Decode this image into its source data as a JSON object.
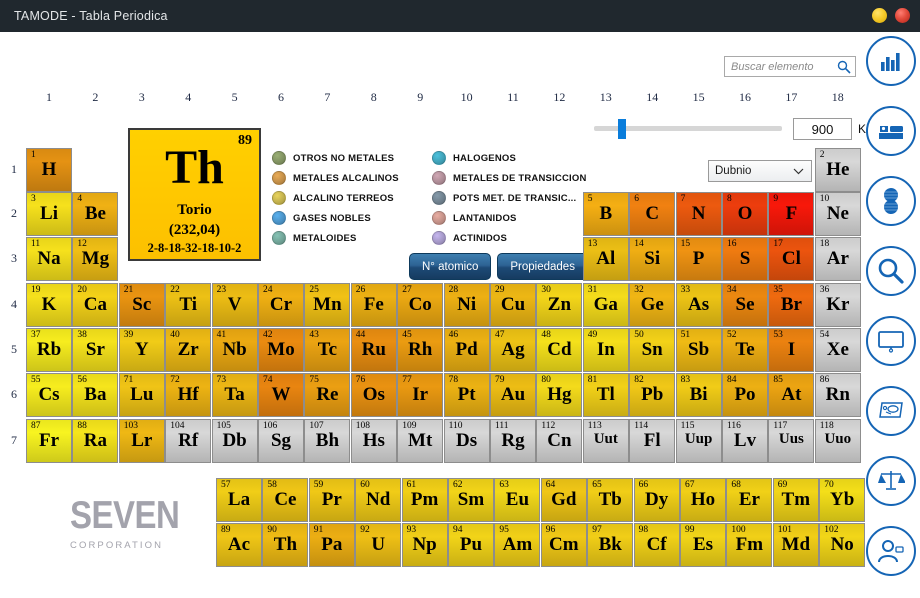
{
  "window": {
    "title": "TAMODE - Tabla Periodica",
    "minimize_label": "",
    "close_label": ""
  },
  "search": {
    "placeholder": "Buscar elemento",
    "value": "",
    "icon": "search-icon"
  },
  "temperature": {
    "value": "900",
    "unit": "K",
    "slider_min": "0",
    "slider_max": "6000"
  },
  "element_select": {
    "value": "Dubnio",
    "arrow_icon": "chevron-down-icon"
  },
  "selected_element": {
    "number": "89",
    "symbol": "Th",
    "name": "Torio",
    "mass": "(232,04)",
    "config": "2-8-18-32-18-10-2"
  },
  "mode_buttons": [
    {
      "label": "N° atomico"
    },
    {
      "label": "Propiedades"
    }
  ],
  "legend": {
    "left": [
      {
        "label": "OTROS NO METALES",
        "color": "#7f9060"
      },
      {
        "label": "METALES ALCALINOS",
        "color": "#c08d47"
      },
      {
        "label": "ALCALINO TERREOS",
        "color": "#bfae4c"
      },
      {
        "label": "GASES NOBLES",
        "color": "#4a91c4"
      },
      {
        "label": "METALOIDES",
        "color": "#6fa195"
      }
    ],
    "right": [
      {
        "label": "HALOGENOS",
        "color": "#3f9fb5"
      },
      {
        "label": "METALES DE TRANSICCION",
        "color": "#ab8a94"
      },
      {
        "label": "POTS MET.  DE TRANSIC...",
        "color": "#6e7f8c"
      },
      {
        "label": "LANTANIDOS",
        "color": "#c08f86"
      },
      {
        "label": "ACTINIDOS",
        "color": "#a296c4"
      }
    ]
  },
  "group_numbers": [
    "1",
    "2",
    "3",
    "4",
    "5",
    "6",
    "7",
    "8",
    "9",
    "10",
    "11",
    "12",
    "13",
    "14",
    "15",
    "16",
    "17",
    "18"
  ],
  "period_numbers": [
    "1",
    "2",
    "3",
    "4",
    "5",
    "6",
    "7"
  ],
  "sidebar_icons": [
    {
      "name": "bar-chart-icon"
    },
    {
      "name": "bed-icon"
    },
    {
      "name": "atom-icon"
    },
    {
      "name": "magnifier-icon"
    },
    {
      "name": "monitor-icon"
    },
    {
      "name": "lab-tray-icon"
    },
    {
      "name": "balance-scale-icon"
    },
    {
      "name": "user-icon"
    }
  ],
  "branding": {
    "name": "SEVEN",
    "tagline": "CORPORATION"
  },
  "elements": [
    {
      "n": "1",
      "s": "H",
      "g": 1,
      "p": 1,
      "c": "#d88a12"
    },
    {
      "n": "2",
      "s": "He",
      "g": 18,
      "p": 1,
      "c": "#cccccc"
    },
    {
      "n": "3",
      "s": "Li",
      "g": 1,
      "p": 2,
      "c": "#e8d41a"
    },
    {
      "n": "4",
      "s": "Be",
      "g": 2,
      "p": 2,
      "c": "#e2a713"
    },
    {
      "n": "5",
      "s": "B",
      "g": 13,
      "p": 2,
      "c": "#e7a512"
    },
    {
      "n": "6",
      "s": "C",
      "g": 14,
      "p": 2,
      "c": "#e37a10"
    },
    {
      "n": "7",
      "s": "N",
      "g": 15,
      "p": 2,
      "c": "#e0550e"
    },
    {
      "n": "8",
      "s": "O",
      "g": 16,
      "p": 2,
      "c": "#e03a0c"
    },
    {
      "n": "9",
      "s": "F",
      "g": 17,
      "p": 2,
      "c": "#ea1709"
    },
    {
      "n": "10",
      "s": "Ne",
      "g": 18,
      "p": 2,
      "c": "#cccccc"
    },
    {
      "n": "11",
      "s": "Na",
      "g": 1,
      "p": 3,
      "c": "#e8d41a"
    },
    {
      "n": "12",
      "s": "Mg",
      "g": 2,
      "p": 3,
      "c": "#e2b414"
    },
    {
      "n": "13",
      "s": "Al",
      "g": 13,
      "p": 3,
      "c": "#dfb414"
    },
    {
      "n": "14",
      "s": "Si",
      "g": 14,
      "p": 3,
      "c": "#e2a412"
    },
    {
      "n": "15",
      "s": "P",
      "g": 15,
      "p": 3,
      "c": "#e28b11"
    },
    {
      "n": "16",
      "s": "S",
      "g": 16,
      "p": 3,
      "c": "#e2740f"
    },
    {
      "n": "17",
      "s": "Cl",
      "g": 17,
      "p": 3,
      "c": "#df4f0d"
    },
    {
      "n": "18",
      "s": "Ar",
      "g": 18,
      "p": 3,
      "c": "#cccccc"
    },
    {
      "n": "19",
      "s": "K",
      "g": 1,
      "p": 4,
      "c": "#e8d41a"
    },
    {
      "n": "20",
      "s": "Ca",
      "g": 2,
      "p": 4,
      "c": "#e6c617"
    },
    {
      "n": "21",
      "s": "Sc",
      "g": 3,
      "p": 4,
      "c": "#dd8c10"
    },
    {
      "n": "22",
      "s": "Ti",
      "g": 4,
      "p": 4,
      "c": "#e0b614"
    },
    {
      "n": "23",
      "s": "V",
      "g": 5,
      "p": 4,
      "c": "#e0b213"
    },
    {
      "n": "24",
      "s": "Cr",
      "g": 6,
      "p": 4,
      "c": "#e2a612"
    },
    {
      "n": "25",
      "s": "Mn",
      "g": 7,
      "p": 4,
      "c": "#e3b714"
    },
    {
      "n": "26",
      "s": "Fe",
      "g": 8,
      "p": 4,
      "c": "#e0a712"
    },
    {
      "n": "27",
      "s": "Co",
      "g": 9,
      "p": 4,
      "c": "#df9f11"
    },
    {
      "n": "28",
      "s": "Ni",
      "g": 10,
      "p": 4,
      "c": "#e0a612"
    },
    {
      "n": "29",
      "s": "Cu",
      "g": 11,
      "p": 4,
      "c": "#e0ad13"
    },
    {
      "n": "30",
      "s": "Zn",
      "g": 12,
      "p": 4,
      "c": "#e6ca18"
    },
    {
      "n": "31",
      "s": "Ga",
      "g": 13,
      "p": 4,
      "c": "#e7d019"
    },
    {
      "n": "32",
      "s": "Ge",
      "g": 14,
      "p": 4,
      "c": "#e3ac13"
    },
    {
      "n": "33",
      "s": "As",
      "g": 15,
      "p": 4,
      "c": "#e0b914"
    },
    {
      "n": "34",
      "s": "Se",
      "g": 16,
      "p": 4,
      "c": "#df800f"
    },
    {
      "n": "35",
      "s": "Br",
      "g": 17,
      "p": 4,
      "c": "#e1640e"
    },
    {
      "n": "36",
      "s": "Kr",
      "g": 18,
      "p": 4,
      "c": "#cccccc"
    },
    {
      "n": "37",
      "s": "Rb",
      "g": 1,
      "p": 5,
      "c": "#e9e01c"
    },
    {
      "n": "38",
      "s": "Sr",
      "g": 2,
      "p": 5,
      "c": "#e8d61a"
    },
    {
      "n": "39",
      "s": "Y",
      "g": 3,
      "p": 5,
      "c": "#e3c016"
    },
    {
      "n": "40",
      "s": "Zr",
      "g": 4,
      "p": 5,
      "c": "#e1b013"
    },
    {
      "n": "41",
      "s": "Nb",
      "g": 5,
      "p": 5,
      "c": "#dfa011"
    },
    {
      "n": "42",
      "s": "Mo",
      "g": 6,
      "p": 5,
      "c": "#de830f"
    },
    {
      "n": "43",
      "s": "Tc",
      "g": 7,
      "p": 5,
      "c": "#df9b11"
    },
    {
      "n": "44",
      "s": "Ru",
      "g": 8,
      "p": 5,
      "c": "#dd8610"
    },
    {
      "n": "45",
      "s": "Rh",
      "g": 9,
      "p": 5,
      "c": "#de9310"
    },
    {
      "n": "46",
      "s": "Pd",
      "g": 10,
      "p": 5,
      "c": "#dfa712"
    },
    {
      "n": "47",
      "s": "Ag",
      "g": 11,
      "p": 5,
      "c": "#e0b814"
    },
    {
      "n": "48",
      "s": "Cd",
      "g": 12,
      "p": 5,
      "c": "#e7d419"
    },
    {
      "n": "49",
      "s": "In",
      "g": 13,
      "p": 5,
      "c": "#e7d219"
    },
    {
      "n": "50",
      "s": "Sn",
      "g": 14,
      "p": 5,
      "c": "#e5c617"
    },
    {
      "n": "51",
      "s": "Sb",
      "g": 15,
      "p": 5,
      "c": "#e2b013"
    },
    {
      "n": "52",
      "s": "Te",
      "g": 16,
      "p": 5,
      "c": "#e1a412"
    },
    {
      "n": "53",
      "s": "I",
      "g": 17,
      "p": 5,
      "c": "#df7b0f"
    },
    {
      "n": "54",
      "s": "Xe",
      "g": 18,
      "p": 5,
      "c": "#cccccc"
    },
    {
      "n": "55",
      "s": "Cs",
      "g": 1,
      "p": 6,
      "c": "#e9e01c"
    },
    {
      "n": "56",
      "s": "Ba",
      "g": 2,
      "p": 6,
      "c": "#e8d81a"
    },
    {
      "n": "71",
      "s": "Lu",
      "g": 3,
      "p": 6,
      "c": "#e2b915"
    },
    {
      "n": "72",
      "s": "Hf",
      "g": 4,
      "p": 6,
      "c": "#e0a912"
    },
    {
      "n": "73",
      "s": "Ta",
      "g": 5,
      "p": 6,
      "c": "#e0ad13"
    },
    {
      "n": "74",
      "s": "W",
      "g": 6,
      "p": 6,
      "c": "#dc7d0f"
    },
    {
      "n": "75",
      "s": "Re",
      "g": 7,
      "p": 6,
      "c": "#de9611"
    },
    {
      "n": "76",
      "s": "Os",
      "g": 8,
      "p": 6,
      "c": "#dd8a10"
    },
    {
      "n": "77",
      "s": "Ir",
      "g": 9,
      "p": 6,
      "c": "#dd9010"
    },
    {
      "n": "78",
      "s": "Pt",
      "g": 10,
      "p": 6,
      "c": "#dfa812"
    },
    {
      "n": "79",
      "s": "Au",
      "g": 11,
      "p": 6,
      "c": "#e0b213"
    },
    {
      "n": "80",
      "s": "Hg",
      "g": 12,
      "p": 6,
      "c": "#e6cf19"
    },
    {
      "n": "81",
      "s": "Tl",
      "g": 13,
      "p": 6,
      "c": "#e4c517"
    },
    {
      "n": "82",
      "s": "Pb",
      "g": 14,
      "p": 6,
      "c": "#e3bd16"
    },
    {
      "n": "83",
      "s": "Bi",
      "g": 15,
      "p": 6,
      "c": "#e3c016"
    },
    {
      "n": "84",
      "s": "Po",
      "g": 16,
      "p": 6,
      "c": "#e0a612"
    },
    {
      "n": "85",
      "s": "At",
      "g": 17,
      "p": 6,
      "c": "#df9b11"
    },
    {
      "n": "86",
      "s": "Rn",
      "g": 18,
      "p": 6,
      "c": "#cccccc"
    },
    {
      "n": "87",
      "s": "Fr",
      "g": 1,
      "p": 7,
      "c": "#eae61e"
    },
    {
      "n": "88",
      "s": "Ra",
      "g": 2,
      "p": 7,
      "c": "#e8d81a"
    },
    {
      "n": "103",
      "s": "Lr",
      "g": 3,
      "p": 7,
      "c": "#e1ae13"
    },
    {
      "n": "104",
      "s": "Rf",
      "g": 4,
      "p": 7,
      "c": "#cccccc"
    },
    {
      "n": "105",
      "s": "Db",
      "g": 5,
      "p": 7,
      "c": "#cccccc"
    },
    {
      "n": "106",
      "s": "Sg",
      "g": 6,
      "p": 7,
      "c": "#cccccc"
    },
    {
      "n": "107",
      "s": "Bh",
      "g": 7,
      "p": 7,
      "c": "#cccccc"
    },
    {
      "n": "108",
      "s": "Hs",
      "g": 8,
      "p": 7,
      "c": "#cccccc"
    },
    {
      "n": "109",
      "s": "Mt",
      "g": 9,
      "p": 7,
      "c": "#cccccc"
    },
    {
      "n": "110",
      "s": "Ds",
      "g": 10,
      "p": 7,
      "c": "#cccccc"
    },
    {
      "n": "111",
      "s": "Rg",
      "g": 11,
      "p": 7,
      "c": "#cccccc"
    },
    {
      "n": "112",
      "s": "Cn",
      "g": 12,
      "p": 7,
      "c": "#cccccc"
    },
    {
      "n": "113",
      "s": "Uut",
      "g": 13,
      "p": 7,
      "c": "#cccccc"
    },
    {
      "n": "114",
      "s": "Fl",
      "g": 14,
      "p": 7,
      "c": "#cccccc"
    },
    {
      "n": "115",
      "s": "Uup",
      "g": 15,
      "p": 7,
      "c": "#cccccc"
    },
    {
      "n": "116",
      "s": "Lv",
      "g": 16,
      "p": 7,
      "c": "#cccccc"
    },
    {
      "n": "117",
      "s": "Uus",
      "g": 17,
      "p": 7,
      "c": "#cccccc"
    },
    {
      "n": "118",
      "s": "Uuo",
      "g": 18,
      "p": 7,
      "c": "#cccccc"
    }
  ],
  "lanthanides": [
    {
      "n": "57",
      "s": "La",
      "c": "#e3c216"
    },
    {
      "n": "58",
      "s": "Ce",
      "c": "#e2bb15"
    },
    {
      "n": "59",
      "s": "Pr",
      "c": "#e2bd15"
    },
    {
      "n": "60",
      "s": "Nd",
      "c": "#e3c016"
    },
    {
      "n": "61",
      "s": "Pm",
      "c": "#e3c316"
    },
    {
      "n": "62",
      "s": "Sm",
      "c": "#e4c817"
    },
    {
      "n": "63",
      "s": "Eu",
      "c": "#e5cd18"
    },
    {
      "n": "64",
      "s": "Gd",
      "c": "#e2bb15"
    },
    {
      "n": "65",
      "s": "Tb",
      "c": "#e3c216"
    },
    {
      "n": "66",
      "s": "Dy",
      "c": "#e3c416"
    },
    {
      "n": "67",
      "s": "Ho",
      "c": "#e3c316"
    },
    {
      "n": "68",
      "s": "Er",
      "c": "#e3c516"
    },
    {
      "n": "69",
      "s": "Tm",
      "c": "#e4c917"
    },
    {
      "n": "70",
      "s": "Yb",
      "c": "#e6d218"
    }
  ],
  "actinides": [
    {
      "n": "89",
      "s": "Ac",
      "c": "#e2bb15"
    },
    {
      "n": "90",
      "s": "Th",
      "c": "#e1b013"
    },
    {
      "n": "91",
      "s": "Pa",
      "c": "#dfa412"
    },
    {
      "n": "92",
      "s": "U",
      "c": "#e1b514"
    },
    {
      "n": "93",
      "s": "Np",
      "c": "#e3c316"
    },
    {
      "n": "94",
      "s": "Pu",
      "c": "#e4c817"
    },
    {
      "n": "95",
      "s": "Am",
      "c": "#e3c416"
    },
    {
      "n": "96",
      "s": "Cm",
      "c": "#e2bd15"
    },
    {
      "n": "97",
      "s": "Bk",
      "c": "#e3c216"
    },
    {
      "n": "98",
      "s": "Cf",
      "c": "#e3c516"
    },
    {
      "n": "99",
      "s": "Es",
      "c": "#e4c917"
    },
    {
      "n": "100",
      "s": "Fm",
      "c": "#e3c416"
    },
    {
      "n": "101",
      "s": "Md",
      "c": "#e3c216"
    },
    {
      "n": "102",
      "s": "No",
      "c": "#e4ca17"
    }
  ]
}
